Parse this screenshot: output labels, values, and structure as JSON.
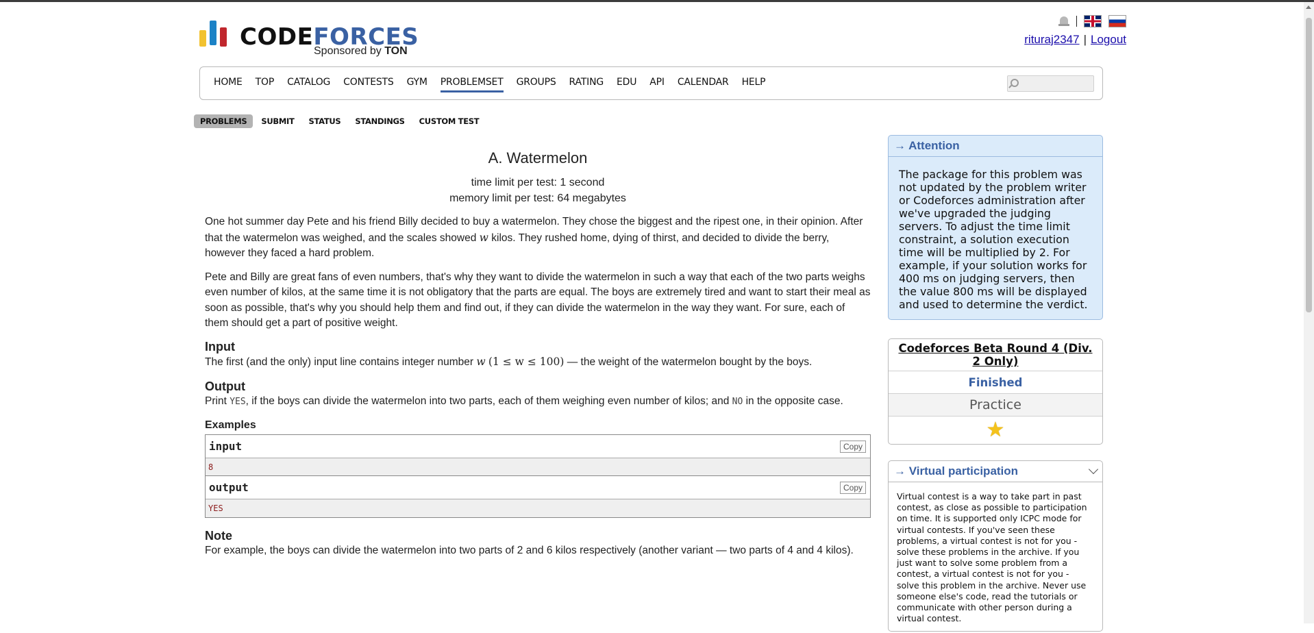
{
  "header": {
    "logo": {
      "word_part1": "CODE",
      "word_part2": "FORCES",
      "sponsor_text": "Sponsored by",
      "sponsor_brand": "TON"
    },
    "separator": "|",
    "user": {
      "username": "rituraj2347",
      "logout": "Logout"
    }
  },
  "main_menu": {
    "items": [
      "HOME",
      "TOP",
      "CATALOG",
      "CONTESTS",
      "GYM",
      "PROBLEMSET",
      "GROUPS",
      "RATING",
      "EDU",
      "API",
      "CALENDAR",
      "HELP"
    ],
    "active": "PROBLEMSET",
    "search_placeholder": ""
  },
  "sub_menu": {
    "items": [
      "PROBLEMS",
      "SUBMIT",
      "STATUS",
      "STANDINGS",
      "CUSTOM TEST"
    ],
    "active": "PROBLEMS"
  },
  "problem": {
    "title": "A. Watermelon",
    "time_limit": "time limit per test: 1 second",
    "memory_limit": "memory limit per test: 64 megabytes",
    "statement_p1_a": "One hot summer day Pete and his friend Billy decided to buy a watermelon. They chose the biggest and the ripest one, in their opinion. After that the watermelon was weighed, and the scales showed ",
    "statement_p1_var": "w",
    "statement_p1_b": " kilos. They rushed home, dying of thirst, and decided to divide the berry, however they faced a hard problem.",
    "statement_p2": "Pete and Billy are great fans of even numbers, that's why they want to divide the watermelon in such a way that each of the two parts weighs even number of kilos, at the same time it is not obligatory that the parts are equal. The boys are extremely tired and want to start their meal as soon as possible, that's why you should help them and find out, if they can divide the watermelon in the way they want. For sure, each of them should get a part of positive weight.",
    "input_title": "Input",
    "input_text_a": "The first (and the only) input line contains integer number ",
    "input_var": "w",
    "input_constraint": "(1 ≤ w ≤ 100)",
    "input_text_b": " — the weight of the watermelon bought by the boys.",
    "output_title": "Output",
    "output_text_a": "Print ",
    "output_yes": "YES",
    "output_text_b": ", if the boys can divide the watermelon into two parts, each of them weighing even number of kilos; and ",
    "output_no": "NO",
    "output_text_c": " in the opposite case.",
    "examples_title": "Examples",
    "example_input_label": "input",
    "example_input_value": "8",
    "example_output_label": "output",
    "example_output_value": "YES",
    "copy_label": "Copy",
    "note_title": "Note",
    "note_text": "For example, the boys can divide the watermelon into two parts of 2 and 6 kilos respectively (another variant — two parts of 4 and 4 kilos)."
  },
  "sidebar": {
    "attention": {
      "title": "→ Attention",
      "text": "The package for this problem was not updated by the problem writer or Codeforces administration after we've upgraded the judging servers. To adjust the time limit constraint, a solution execution time will be multiplied by 2. For example, if your solution works for 400 ms on judging servers, then the value 800 ms will be displayed and used to determine the verdict."
    },
    "contest": {
      "name": "Codeforces Beta Round 4 (Div. 2 Only)",
      "status": "Finished",
      "mode": "Practice"
    },
    "virtual": {
      "title": "→ Virtual participation",
      "text": "Virtual contest is a way to take part in past contest, as close as possible to participation on time. It is supported only ICPC mode for virtual contests. If you've seen these problems, a virtual contest is not for you - solve these problems in the archive. If you just want to solve some problem from a contest, a virtual contest is not for you - solve this problem in the archive. Never use someone else's code, read the tutorials or communicate with other person during a virtual contest."
    }
  },
  "colors": {
    "accent": "#3a61a3",
    "attention_bg": "#dbebfa",
    "link": "#1a0dab"
  },
  "icons": [
    "bell-icon",
    "uk-flag-icon",
    "ru-flag-icon",
    "search-icon",
    "star-icon",
    "chevron-down-icon"
  ]
}
